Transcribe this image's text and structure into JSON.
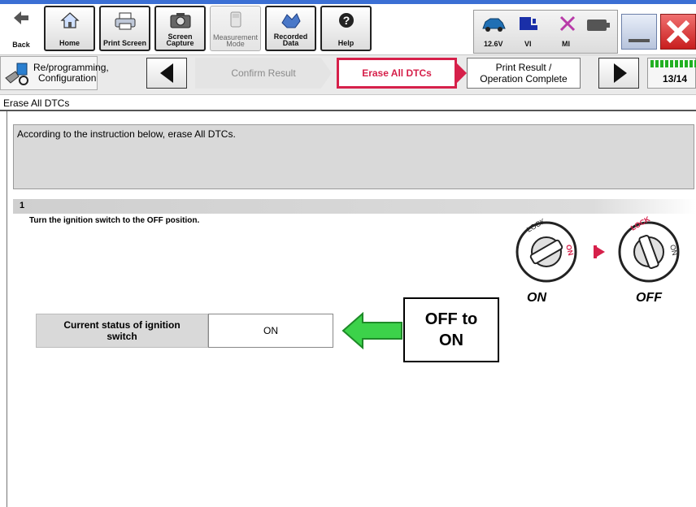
{
  "toolbar": {
    "back_label": "Back",
    "home_label": "Home",
    "print_screen_label": "Print Screen",
    "screen_capture_label_1": "Screen",
    "screen_capture_label_2": "Capture",
    "measurement_mode_label_1": "Measurement",
    "measurement_mode_label_2": "Mode",
    "recorded_data_label_1": "Recorded",
    "recorded_data_label_2": "Data",
    "help_label": "Help"
  },
  "status": {
    "voltage": "12.6V",
    "vi_label": "VI",
    "mi_label": "MI"
  },
  "nav": {
    "title_line1": "Re/programming,",
    "title_line2": "Configuration",
    "step_confirm": "Confirm Result",
    "step_erase": "Erase All DTCs",
    "step_print_line1": "Print Result /",
    "step_print_line2": "Operation Complete",
    "page_counter": "13/14"
  },
  "page": {
    "title": "Erase All DTCs",
    "instruction": "According to the instruction below, erase All DTCs.",
    "step_number": "1",
    "step_text": "Turn the ignition switch to the OFF position.",
    "ignition_on_label": "ON",
    "ignition_off_label": "OFF",
    "status_label_line1": "Current status of ignition",
    "status_label_line2": "switch",
    "status_value": "ON",
    "callout_line1": "OFF to",
    "callout_line2": "ON"
  },
  "colors": {
    "accent_red": "#d6204a",
    "arrow_green": "#3cd24a",
    "title_bar_blue": "#3b6fd4"
  }
}
